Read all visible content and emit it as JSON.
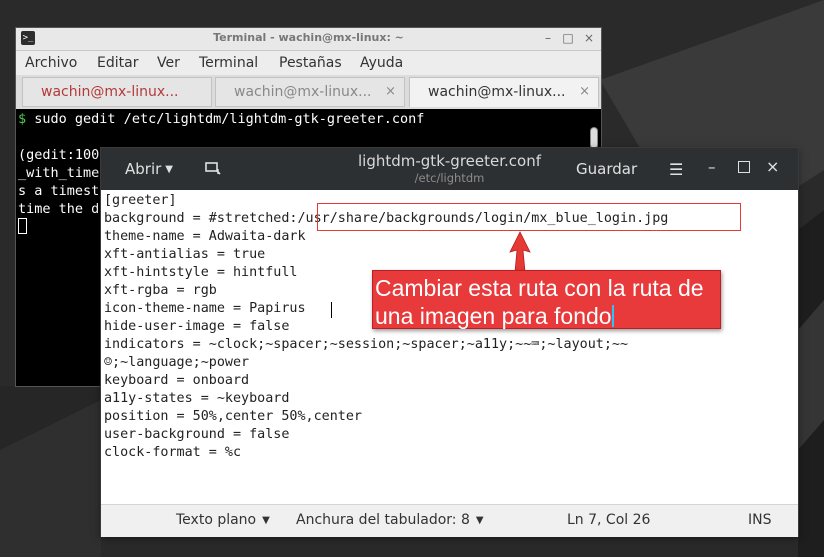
{
  "terminal": {
    "title": "Terminal - wachin@mx-linux: ~",
    "menu": [
      "Archivo",
      "Editar",
      "Ver",
      "Terminal",
      "Pestañas",
      "Ayuda"
    ],
    "tabs": [
      {
        "label": "wachin@mx-linux...",
        "close": "×"
      },
      {
        "label": "wachin@mx-linux...",
        "close": "×"
      },
      {
        "label": "wachin@mx-linux...",
        "close": "×"
      }
    ],
    "prompt": "$",
    "lines": [
      "sudo gedit /etc/lightdm/lightdm-gtk-greeter.conf",
      "",
      "(gedit:100",
      "_with_time",
      "s a timest",
      "time the d"
    ],
    "controls": {
      "minimize": "–",
      "maximize": "□",
      "close": "×"
    }
  },
  "gedit": {
    "open_label": "Abrir",
    "title": "lightdm-gtk-greeter.conf",
    "subtitle": "/etc/lightdm",
    "save_label": "Guardar",
    "menu_icon": "☰",
    "controls": {
      "minimize": "–",
      "close": "×"
    },
    "lines": [
      "[greeter]",
      "background = #stretched:/usr/share/backgrounds/login/mx_blue_login.jpg",
      "theme-name = Adwaita-dark",
      "xft-antialias = true",
      "xft-hintstyle = hintfull",
      "xft-rgba = rgb",
      "icon-theme-name = Papirus",
      "hide-user-image = false",
      "indicators = ~clock;~spacer;~session;~spacer;~a11y;~~⌨;~layout;~~",
      "☺;~language;~power",
      "keyboard = onboard",
      "a11y-states = ~keyboard",
      "position = 50%,center 50%,center",
      "user-background = false",
      "clock-format = %c"
    ],
    "status": {
      "language": "Texto plano",
      "tab_width": "Anchura del tabulador: 8",
      "position": "Ln 7, Col 26",
      "mode": "INS"
    }
  },
  "annotation": {
    "text_line1": "Cambiar esta ruta con la ruta de",
    "text_line2": "una imagen para fondo",
    "color": "#e8393b"
  }
}
